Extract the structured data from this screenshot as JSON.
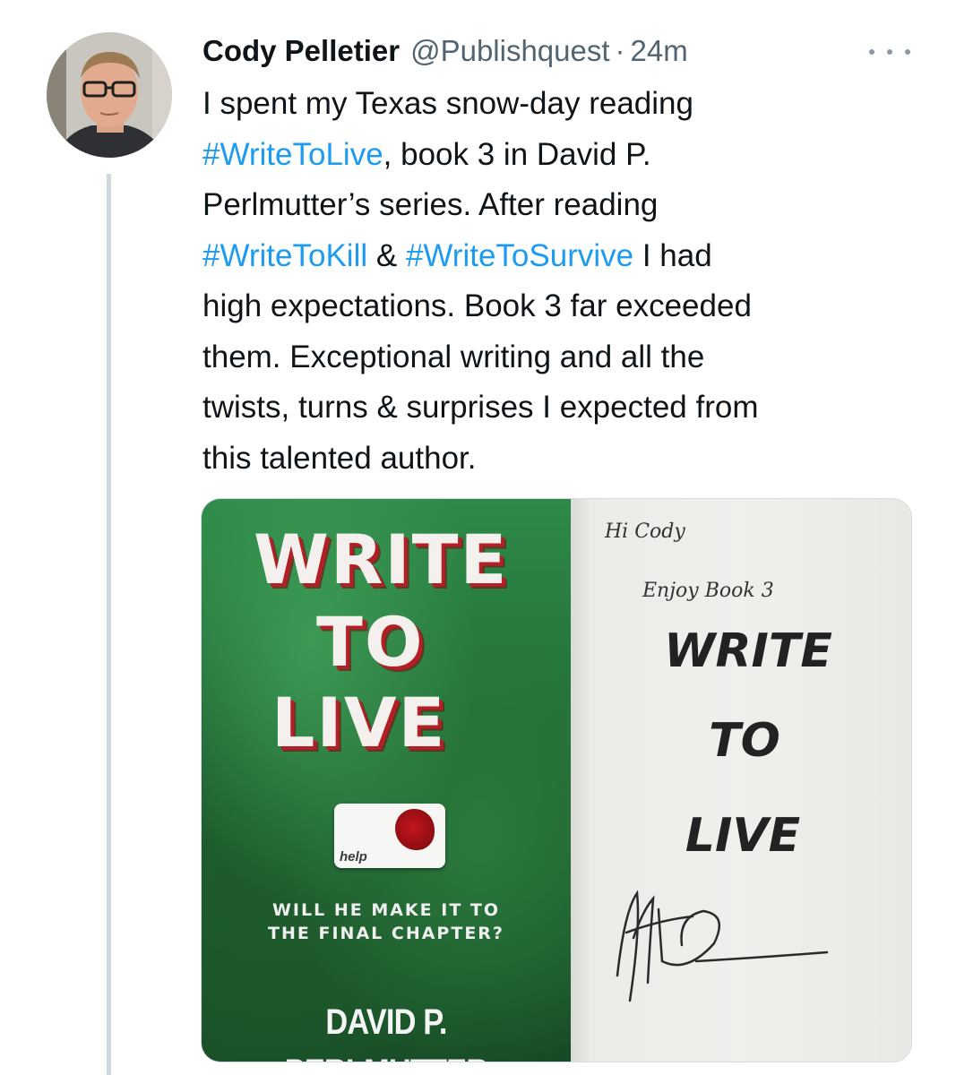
{
  "tweet": {
    "author_name": "Cody Pelletier",
    "handle": "@Publishquest",
    "separator": "·",
    "time": "24m",
    "text_lines": [
      [
        {
          "t": "I spent my Texas snow-day reading",
          "tag": false
        }
      ],
      [
        {
          "t": "#WriteToLive",
          "tag": true
        },
        {
          "t": ", book 3 in David P.",
          "tag": false
        }
      ],
      [
        {
          "t": "Perlmutter’s series. After reading",
          "tag": false
        }
      ],
      [
        {
          "t": "#WriteToKill",
          "tag": true
        },
        {
          "t": " & ",
          "tag": false
        },
        {
          "t": "#WriteToSurvive",
          "tag": true
        },
        {
          "t": " I had",
          "tag": false
        }
      ],
      [
        {
          "t": "high expectations. Book 3 far exceeded",
          "tag": false
        }
      ],
      [
        {
          "t": "them. Exceptional writing and all the",
          "tag": false
        }
      ],
      [
        {
          "t": "twists, turns & surprises I expected from",
          "tag": false
        }
      ],
      [
        {
          "t": "this talented author.",
          "tag": false
        }
      ]
    ]
  },
  "media": {
    "cover": {
      "title_line1": "WRITE",
      "title_line2": "TO",
      "title_line3": "LIVE",
      "help_label": "help",
      "tagline_line1": "WILL HE MAKE IT TO",
      "tagline_line2": "THE FINAL CHAPTER?",
      "author": "DAVID P. PERLMUTTER"
    },
    "page": {
      "handwritten_line1": "Hi Cody",
      "handwritten_line2": "Enjoy Book 3",
      "word1": "WRITE",
      "word2": "TO",
      "word3": "LIVE"
    }
  },
  "colors": {
    "hashtag": "#1d9bf0",
    "secondary_text": "#536471",
    "thread_line": "#cfd9de"
  },
  "icons": {
    "more": "more-horizontal-icon"
  }
}
